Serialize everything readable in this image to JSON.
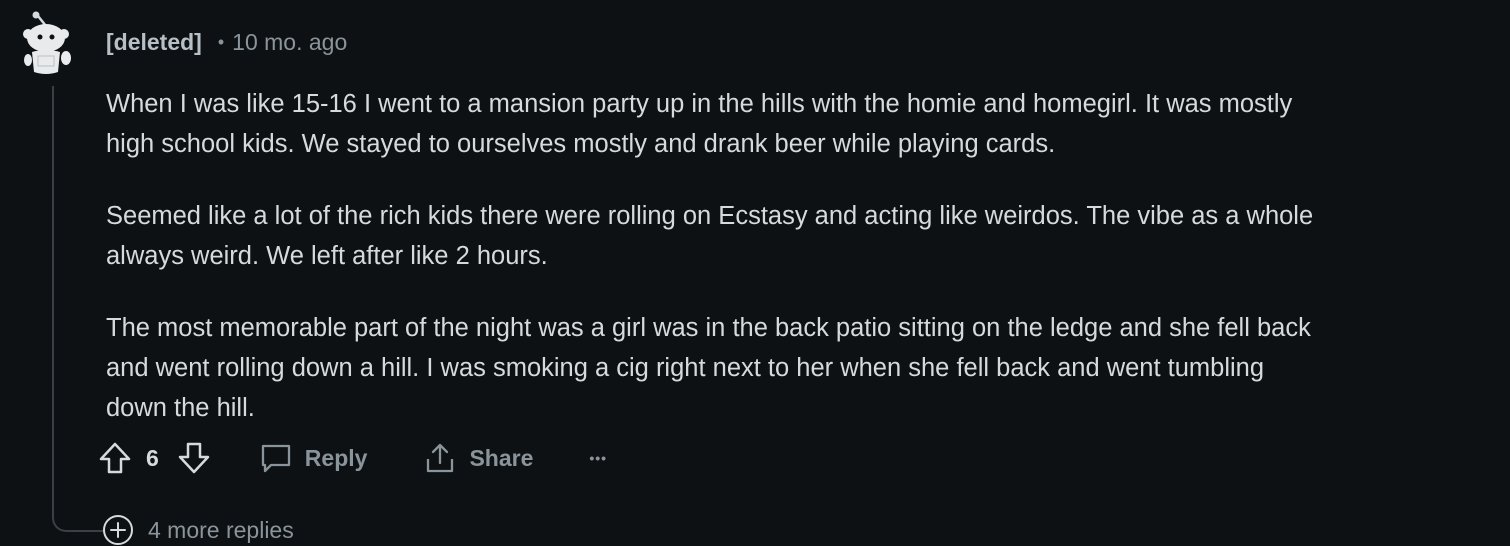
{
  "comment": {
    "author": "[deleted]",
    "separator": "•",
    "timestamp": "10 mo. ago",
    "avatar_icon": "snoo-avatar-icon",
    "paragraphs": [
      {
        "lines": [
          "When I was like 15-16 I went to a mansion party up in the hills with the homie and homegirl. It was mostly",
          "high school kids. We stayed to ourselves mostly and drank beer while playing cards."
        ]
      },
      {
        "lines": [
          "Seemed like a lot of the rich kids there were rolling on Ecstasy and acting like weirdos. The vibe as a whole",
          "always weird. We left after like 2 hours."
        ]
      },
      {
        "lines": [
          "The most memorable part of the night was a girl was in the back patio sitting on the ledge and she fell back",
          "and went rolling down a hill. I was smoking a cig right next to her when she fell back and went tumbling",
          "down the hill."
        ]
      }
    ]
  },
  "actions": {
    "upvote_icon": "upvote-arrow-icon",
    "vote_count": "6",
    "downvote_icon": "downvote-arrow-icon",
    "reply_icon": "speech-bubble-icon",
    "reply_label": "Reply",
    "share_icon": "share-upload-icon",
    "share_label": "Share",
    "more_icon": "ellipsis-icon",
    "more_label": "•••"
  },
  "more_replies": {
    "icon": "plus-circle-icon",
    "label": "4 more replies"
  },
  "colors": {
    "background": "#0e1113",
    "text": "#d7dadc",
    "muted": "#8a949b",
    "thread_line": "#3a4045"
  }
}
